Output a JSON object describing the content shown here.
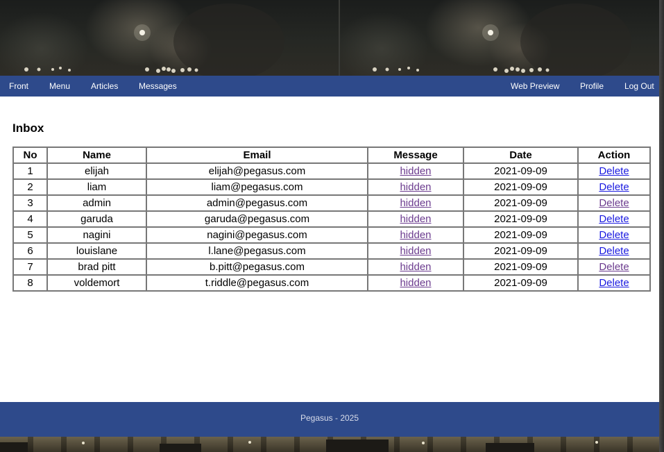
{
  "nav": {
    "left": [
      "Front",
      "Menu",
      "Articles",
      "Messages"
    ],
    "right": [
      "Web Preview",
      "Profile",
      "Log Out"
    ]
  },
  "page_title": "Inbox",
  "table": {
    "headers": [
      "No",
      "Name",
      "Email",
      "Message",
      "Date",
      "Action"
    ],
    "rows": [
      {
        "no": "1",
        "name": "elijah",
        "email": "elijah@pegasus.com",
        "message": "hidden",
        "date": "2021-09-09",
        "action": "Delete"
      },
      {
        "no": "2",
        "name": "liam",
        "email": "liam@pegasus.com",
        "message": "hidden",
        "date": "2021-09-09",
        "action": "Delete"
      },
      {
        "no": "3",
        "name": "admin",
        "email": "admin@pegasus.com",
        "message": "hidden",
        "date": "2021-09-09",
        "action": "Delete"
      },
      {
        "no": "4",
        "name": "garuda",
        "email": "garuda@pegasus.com",
        "message": "hidden",
        "date": "2021-09-09",
        "action": "Delete"
      },
      {
        "no": "5",
        "name": "nagini",
        "email": "nagini@pegasus.com",
        "message": "hidden",
        "date": "2021-09-09",
        "action": "Delete"
      },
      {
        "no": "6",
        "name": "louislane",
        "email": "l.lane@pegasus.com",
        "message": "hidden",
        "date": "2021-09-09",
        "action": "Delete"
      },
      {
        "no": "7",
        "name": "brad pitt",
        "email": "b.pitt@pegasus.com",
        "message": "hidden",
        "date": "2021-09-09",
        "action": "Delete"
      },
      {
        "no": "8",
        "name": "voldemort",
        "email": "t.riddle@pegasus.com",
        "message": "hidden",
        "date": "2021-09-09",
        "action": "Delete"
      }
    ]
  },
  "footer": {
    "text": "Pegasus - 2025"
  },
  "colors": {
    "nav_bg": "#2e4a8b",
    "link_unvisited": "#1a1ae0",
    "link_visited": "#6b3b8e"
  }
}
